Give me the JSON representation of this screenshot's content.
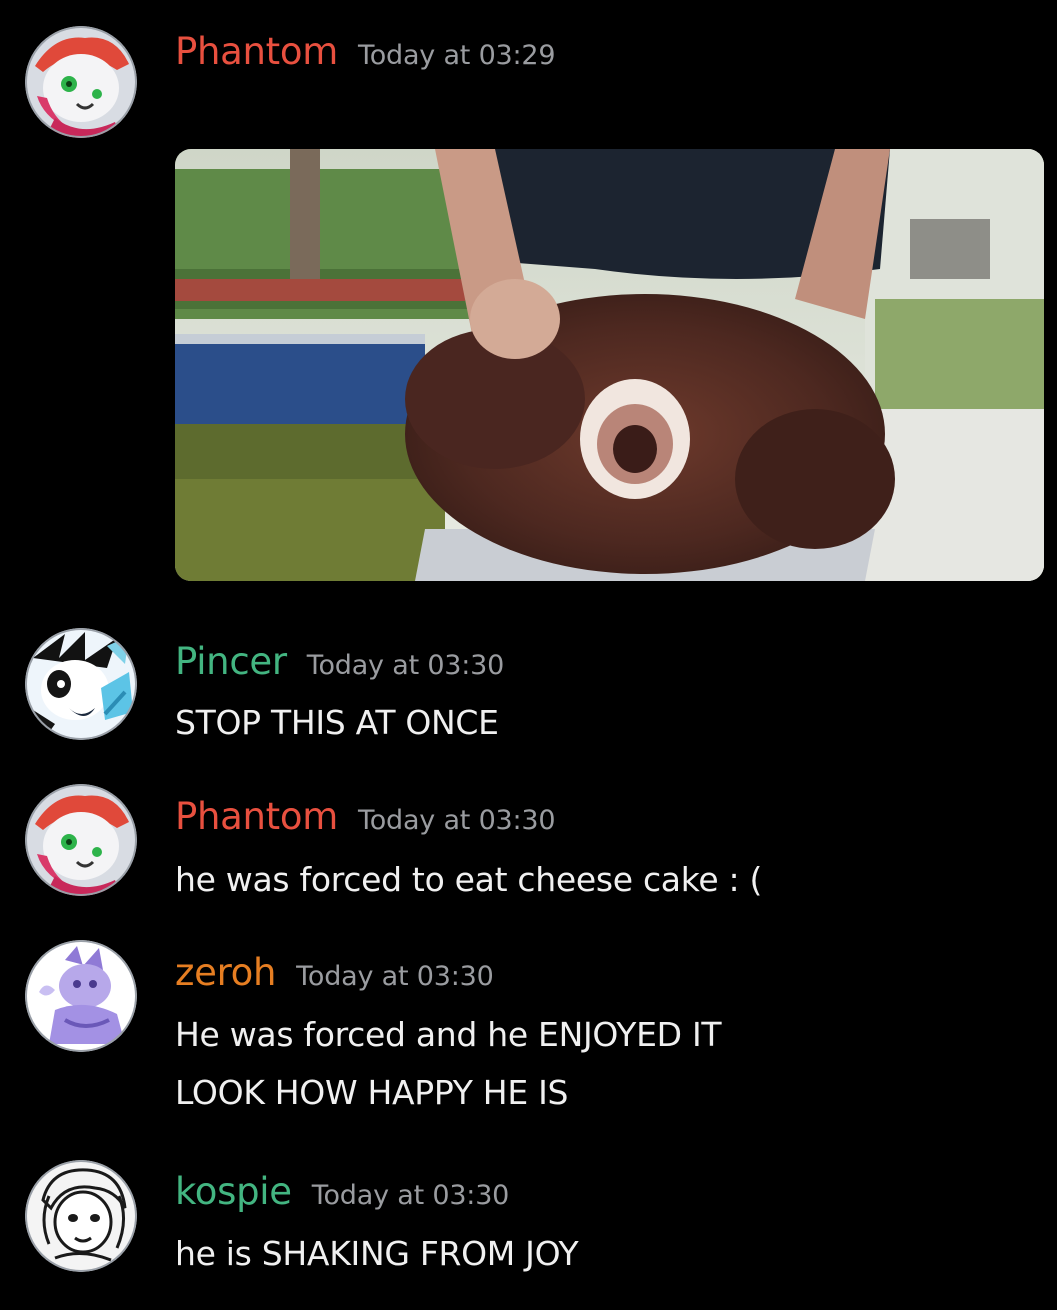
{
  "colors": {
    "background": "#000000",
    "timestamp": "#9a9ca0",
    "message_text": "#f0f0f0"
  },
  "messages": [
    {
      "username": "Phantom",
      "username_color": "#e8503f",
      "timestamp": "Today at 03:29",
      "lines": [],
      "attachment": "gif-image",
      "avatar": "phantom-avatar"
    },
    {
      "username": "Pincer",
      "username_color": "#43b581",
      "timestamp": "Today at 03:30",
      "lines": [
        "STOP THIS AT ONCE"
      ],
      "avatar": "pincer-avatar"
    },
    {
      "username": "Phantom",
      "username_color": "#e8503f",
      "timestamp": "Today at 03:30",
      "lines": [
        "he was forced to eat cheese cake : ("
      ],
      "avatar": "phantom-avatar"
    },
    {
      "username": "zeroh",
      "username_color": "#e67e22",
      "timestamp": "Today at 03:30",
      "lines": [
        "He was forced and he ENJOYED IT",
        "LOOK HOW HAPPY HE IS"
      ],
      "avatar": "zeroh-avatar"
    },
    {
      "username": "kospie",
      "username_color": "#43b581",
      "timestamp": "Today at 03:30",
      "lines": [
        "he is SHAKING FROM JOY"
      ],
      "avatar": "kospie-avatar"
    }
  ]
}
